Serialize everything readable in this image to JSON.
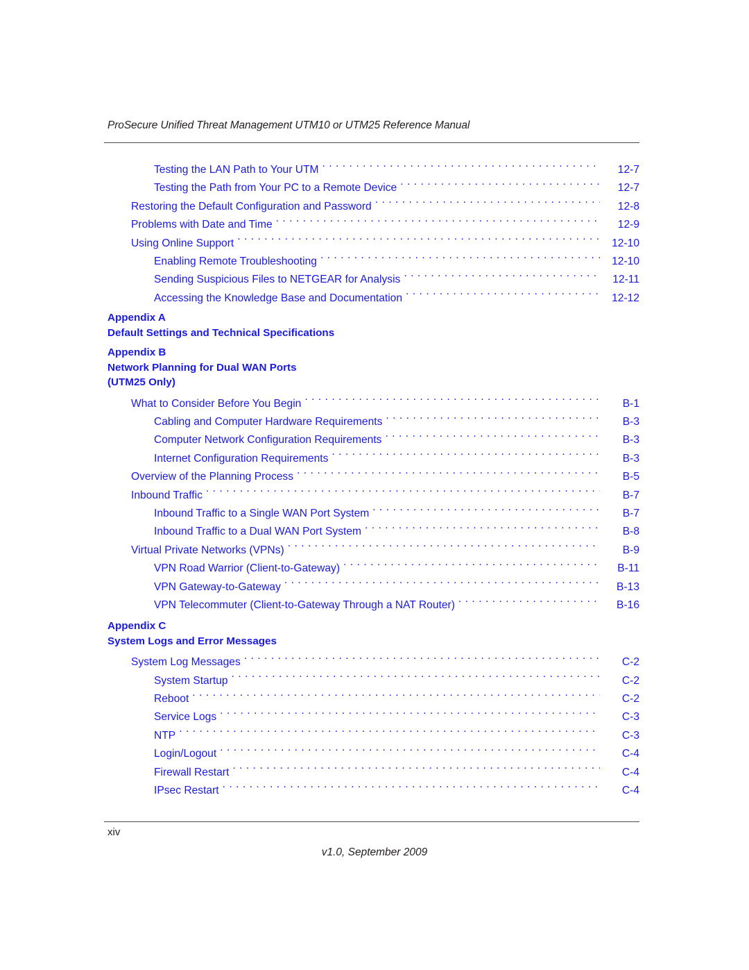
{
  "header": {
    "running_title": "ProSecure Unified Threat Management UTM10 or UTM25 Reference Manual"
  },
  "footer": {
    "page_folio": "xiv",
    "version": "v1.0, September 2009"
  },
  "colors": {
    "link_blue": "#1a1ae0",
    "text_black": "#231f20",
    "rule_gray": "#4a4a4a"
  },
  "toc": {
    "groups": [
      {
        "type": "entries",
        "entries": [
          {
            "level": 2,
            "title": "Testing the LAN Path to Your UTM",
            "page": "12-7"
          },
          {
            "level": 2,
            "title": "Testing the Path from Your PC to a Remote Device",
            "page": "12-7"
          },
          {
            "level": 1,
            "title": "Restoring the Default Configuration and Password",
            "page": "12-8"
          },
          {
            "level": 1,
            "title": "Problems with Date and Time",
            "page": "12-9"
          },
          {
            "level": 1,
            "title": "Using Online Support",
            "page": "12-10"
          },
          {
            "level": 2,
            "title": "Enabling Remote Troubleshooting",
            "page": "12-10"
          },
          {
            "level": 2,
            "title": "Sending Suspicious Files to NETGEAR for Analysis",
            "page": "12-11"
          },
          {
            "level": 2,
            "title": "Accessing the Knowledge Base and Documentation",
            "page": "12-12"
          }
        ]
      },
      {
        "type": "appendix",
        "id": "a",
        "lines": [
          "Appendix A",
          "Default Settings and Technical Specifications"
        ]
      },
      {
        "type": "appendix",
        "id": "b",
        "lines": [
          "Appendix B",
          "Network Planning for Dual WAN Ports",
          "(UTM25 Only)"
        ]
      },
      {
        "type": "entries",
        "entries": [
          {
            "level": 1,
            "title": "What to Consider Before You Begin",
            "page": "B-1"
          },
          {
            "level": 2,
            "title": "Cabling and Computer Hardware Requirements",
            "page": "B-3"
          },
          {
            "level": 2,
            "title": "Computer Network Configuration Requirements",
            "page": "B-3"
          },
          {
            "level": 2,
            "title": "Internet Configuration Requirements",
            "page": "B-3"
          },
          {
            "level": 1,
            "title": "Overview of the Planning Process",
            "page": "B-5"
          },
          {
            "level": 1,
            "title": "Inbound Traffic",
            "page": "B-7"
          },
          {
            "level": 2,
            "title": "Inbound Traffic to a Single WAN Port System",
            "page": "B-7"
          },
          {
            "level": 2,
            "title": "Inbound Traffic to a Dual WAN Port System",
            "page": "B-8"
          },
          {
            "level": 1,
            "title": "Virtual Private Networks (VPNs)",
            "page": "B-9"
          },
          {
            "level": 2,
            "title": "VPN Road Warrior (Client-to-Gateway)",
            "page": "B-11"
          },
          {
            "level": 2,
            "title": "VPN Gateway-to-Gateway",
            "page": "B-13"
          },
          {
            "level": 2,
            "title": "VPN Telecommuter (Client-to-Gateway Through a NAT Router)",
            "page": "B-16"
          }
        ]
      },
      {
        "type": "appendix",
        "id": "c",
        "lines": [
          "Appendix C",
          "System Logs and Error Messages"
        ]
      },
      {
        "type": "entries",
        "entries": [
          {
            "level": 1,
            "title": "System Log Messages",
            "page": "C-2"
          },
          {
            "level": 2,
            "title": "System Startup",
            "page": "C-2"
          },
          {
            "level": 2,
            "title": "Reboot",
            "page": "C-2"
          },
          {
            "level": 2,
            "title": "Service Logs",
            "page": "C-3"
          },
          {
            "level": 2,
            "title": "NTP",
            "page": "C-3"
          },
          {
            "level": 2,
            "title": "Login/Logout",
            "page": "C-4"
          },
          {
            "level": 2,
            "title": "Firewall Restart",
            "page": "C-4"
          },
          {
            "level": 2,
            "title": "IPsec Restart",
            "page": "C-4"
          }
        ]
      }
    ]
  }
}
